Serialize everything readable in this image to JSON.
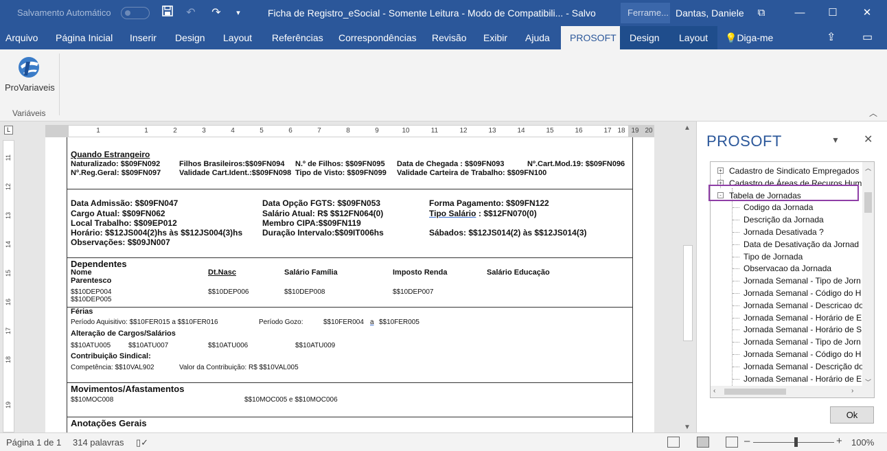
{
  "titlebar": {
    "autosave_label": "Salvamento Automático",
    "doc_title": "Ficha de Registro_eSocial  -  Somente Leitura  -  Modo de Compatibili...  -  Salvo",
    "tools_label": "Ferrame...",
    "user": "Dantas, Daniele"
  },
  "tabs": [
    "Arquivo",
    "Página Inicial",
    "Inserir",
    "Design",
    "Layout",
    "Referências",
    "Correspondências",
    "Revisão",
    "Exibir",
    "Ajuda",
    "PROSOFT",
    "Design",
    "Layout",
    "Diga-me"
  ],
  "ribbon": {
    "button_label": "ProVariaveis",
    "group_label": "Variáveis"
  },
  "ruler": {
    "h_numbers": [
      "1",
      "1",
      "2",
      "3",
      "4",
      "5",
      "6",
      "7",
      "8",
      "9",
      "10",
      "11",
      "12",
      "13",
      "14",
      "15",
      "16",
      "17",
      "18",
      "19",
      "20"
    ],
    "v_numbers": [
      "11",
      "12",
      "13",
      "14",
      "15",
      "16",
      "17",
      "18",
      "19"
    ]
  },
  "document": {
    "estrangeiro": {
      "title": "Quando Estrangeiro",
      "naturalizado": "Naturalizado: $$09FN092",
      "filhos_bras": "Filhos Brasileiros:$$09FN094",
      "num_filhos": "N.º de Filhos: $$09FN095",
      "data_chegada": "Data de Chegada : $$09FN093",
      "cart_mod": "Nº.Cart.Mod.19:  $$09FN096",
      "reg_geral": "Nº.Reg.Geral: $$09FN097",
      "validade_cart": "Validade Cart.Ident.:$$09FN098",
      "tipo_visto": "Tipo de Visto: $$09FN099",
      "validade_trab": "Validade Carteira de Trabalho: $$09FN100"
    },
    "admissao": {
      "data_admissao": "Data Admissão: $$09FN047",
      "data_fgts": "Data Opção FGTS:  $$09FN053",
      "forma_pag": "Forma Pagamento: $$09FN122",
      "cargo": "Cargo Atual: $$09FN062",
      "salario": "Salário Atual: R$ $$12FN064(0)",
      "tipo_salario_label": "Tipo  Salário",
      "tipo_salario_val": ": $$12FN070(0)",
      "local": "Local Trabalho: $$09EP012",
      "cipa": "Membro CIPA:$$09FN119",
      "horario": "Horário: $$12JS004(2)hs às $$12JS004(3)hs",
      "duracao": "Duração Intervalo:$$09IT006hs",
      "sabados": "Sábados:   $$12JS014(2) às $$12JS014(3)",
      "observacoes": "Observações: $$09JN007"
    },
    "dependentes": {
      "title": "Dependentes",
      "col_nome": "Nome",
      "col_nasc": "Dt.Nasc",
      "col_familia": "Salário Família",
      "col_renda": "Imposto Renda",
      "col_educacao": "Salário Educação",
      "col_parentesco": "Parentesco",
      "v_nome": "$$10DEP004",
      "v_nasc": "$$10DEP006",
      "v_familia": "$$10DEP008",
      "v_renda": "$$10DEP007",
      "v_parentesco": "$$10DEP005"
    },
    "ferias": {
      "title": "Férias",
      "periodo_aq": "Período Aquisitivo:   $$10FER015   a    $$10FER016",
      "periodo_gozo": "Período Gozo:",
      "gozo_ini": "$$10FER004",
      "gozo_a": "a",
      "gozo_fim": "$$10FER005",
      "alteracao_title": "Alteração de Cargos/Salários",
      "atu005": "$$10ATU005",
      "atu007": "$$10ATU007",
      "atu006": "$$10ATU006",
      "atu009": "$$10ATU009",
      "contrib_title": "Contribuição Sindical:",
      "competencia": "Competência: $$10VAL902",
      "valor_contrib": "Valor da Contribuição: R$ $$10VAL005"
    },
    "movimentos": {
      "title": "Movimentos/Afastamentos",
      "moc008": "$$10MOC008",
      "moc005": "$$10MOC005 e $$10MOC006"
    },
    "anotacoes": {
      "title": "Anotações Gerais"
    }
  },
  "pane": {
    "title": "PROSOFT",
    "tree": [
      {
        "label": "Cadastro de Sindicato Empregados",
        "level": 0,
        "expander": "+"
      },
      {
        "label": "Cadastro de Áreas de Recuros Hum",
        "level": 0,
        "expander": "+"
      },
      {
        "label": "Tabela de Jornadas",
        "level": 0,
        "expander": "-"
      },
      {
        "label": "Codigo da Jornada",
        "level": 1
      },
      {
        "label": "Descrição da Jornada",
        "level": 1
      },
      {
        "label": "Jornada Desativada ?",
        "level": 1
      },
      {
        "label": "Data de Desativação da Jornad",
        "level": 1
      },
      {
        "label": "Tipo de Jornada",
        "level": 1
      },
      {
        "label": "Observacao da Jornada",
        "level": 1
      },
      {
        "label": "Jornada Semanal - Tipo de Jorn",
        "level": 1
      },
      {
        "label": "Jornada Semanal - Código do H",
        "level": 1
      },
      {
        "label": "Jornada Semanal - Descricao do",
        "level": 1
      },
      {
        "label": "Jornada Semanal - Horário de E",
        "level": 1
      },
      {
        "label": "Jornada Semanal - Horário de S",
        "level": 1
      },
      {
        "label": "Jornada Semanal - Tipo de Jorn",
        "level": 1
      },
      {
        "label": "Jornada Semanal - Código do H",
        "level": 1
      },
      {
        "label": "Jornada Semanal - Descrição do",
        "level": 1
      },
      {
        "label": "Jornada Semanal - Horário de E",
        "level": 1
      }
    ],
    "ok_label": "Ok"
  },
  "status": {
    "page": "Página 1 de 1",
    "words": "314 palavras",
    "zoom": "100%"
  },
  "colors": {
    "brand": "#2b579a",
    "highlight": "#8e3ea6"
  }
}
